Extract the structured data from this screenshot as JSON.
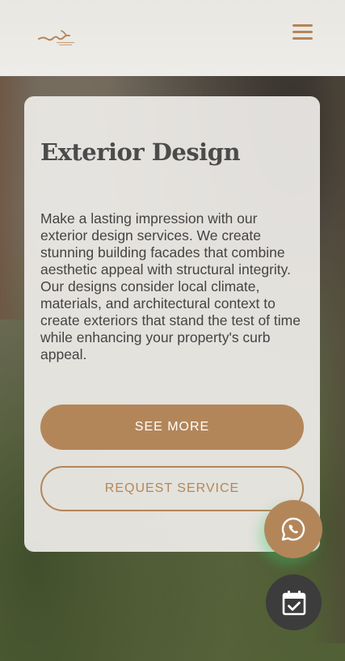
{
  "header": {
    "logo_icon": "brand-logo-icon",
    "menu_icon": "hamburger-menu-icon"
  },
  "card": {
    "title": "Exterior Design",
    "description": "Make a lasting impression with our exterior design services. We create stunning building facades that combine aesthetic appeal with structural integrity. Our designs consider local climate, materials, and architectural context to create exteriors that stand the test of time while enhancing your property's curb appeal.",
    "primary_button": "SEE MORE",
    "secondary_button": "REQUEST SERVICE"
  },
  "floating": {
    "whatsapp_icon": "whatsapp-icon",
    "calendar_icon": "calendar-check-icon"
  },
  "colors": {
    "accent": "#b3865a",
    "dark": "#3c3c3c",
    "header_bg": "#eceae6"
  }
}
